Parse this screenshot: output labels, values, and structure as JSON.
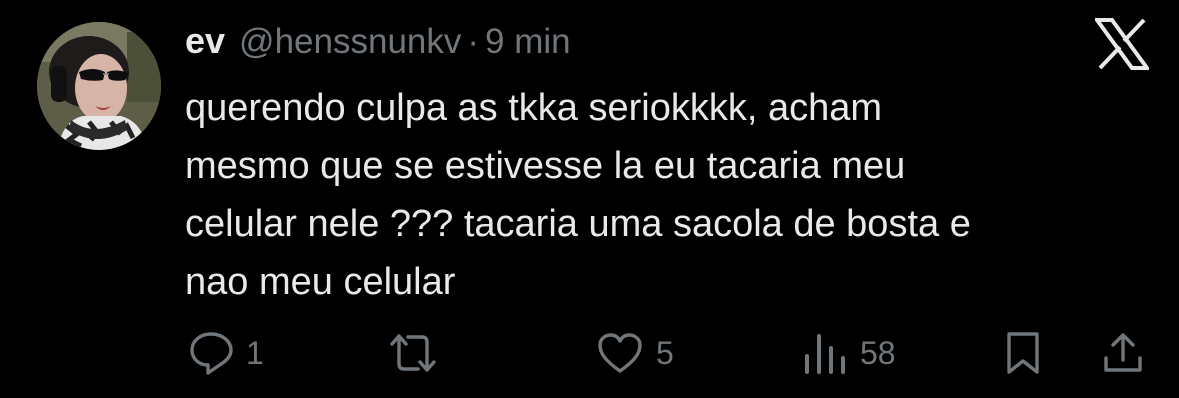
{
  "tweet": {
    "display_name": "ev",
    "handle": "@henssnunkv",
    "separator": "·",
    "time": "9 min",
    "text_lines": [
      "querendo culpa as tkka seriokkkk, acham",
      "mesmo que se estivesse la eu tacaria meu",
      "celular nele ??? tacaria uma sacola de bosta e",
      "nao meu celular"
    ]
  },
  "actions": {
    "reply": {
      "icon": "reply-icon",
      "count": "1"
    },
    "repost": {
      "icon": "repost-icon",
      "count": ""
    },
    "like": {
      "icon": "heart-icon",
      "count": "5"
    },
    "views": {
      "icon": "views-icon",
      "count": "58"
    },
    "bookmark": {
      "icon": "bookmark-icon"
    },
    "share": {
      "icon": "share-icon"
    }
  },
  "colors": {
    "background": "#000000",
    "text_primary": "#e7e9ea",
    "text_secondary": "#71767b"
  }
}
